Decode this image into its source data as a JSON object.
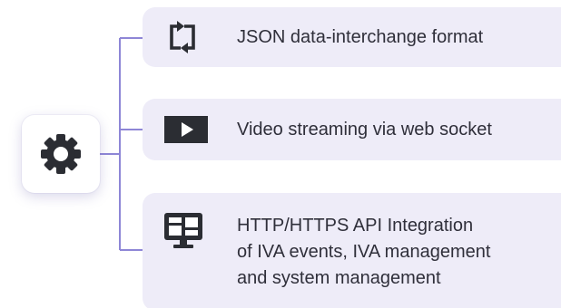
{
  "hub": {
    "icon": "gear-icon",
    "color": "#2b2d33"
  },
  "features": [
    {
      "icon": "sync-arrows-icon",
      "label": "JSON data-interchange format"
    },
    {
      "icon": "video-play-icon",
      "label": "Video streaming via web socket"
    },
    {
      "icon": "monitor-dashboard-icon",
      "label": "HTTP/HTTPS API Integration\nof IVA events, IVA management\nand system management"
    }
  ],
  "colors": {
    "card_background": "#eeecf8",
    "connector": "#8e86d6",
    "icon": "#2b2d33",
    "text": "#2f2f3a"
  }
}
